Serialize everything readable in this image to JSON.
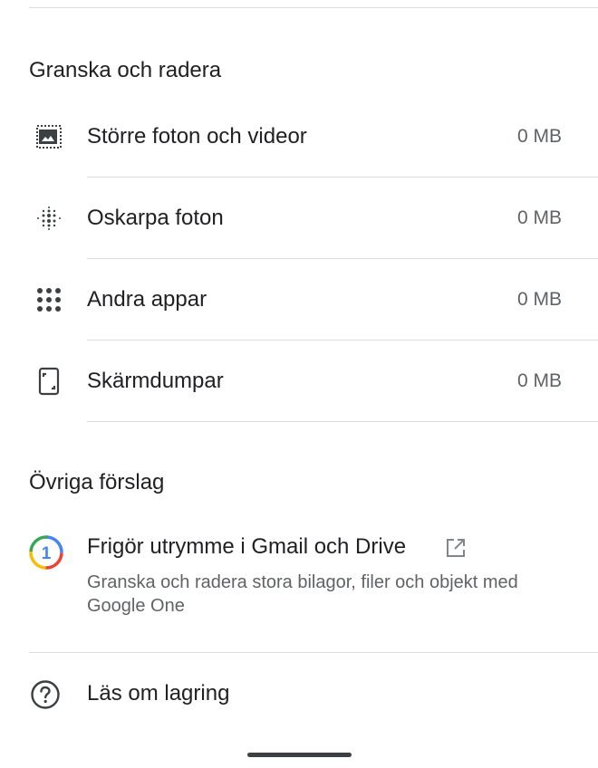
{
  "review": {
    "title": "Granska och radera",
    "items": [
      {
        "label": "Större foton och videor",
        "value": "0 MB",
        "icon": "large-photo-icon"
      },
      {
        "label": "Oskarpa foton",
        "value": "0 MB",
        "icon": "blurry-dots-icon"
      },
      {
        "label": "Andra appar",
        "value": "0 MB",
        "icon": "apps-grid-icon"
      },
      {
        "label": "Skärmdumpar",
        "value": "0 MB",
        "icon": "screenshot-phone-icon"
      }
    ]
  },
  "suggestions": {
    "title": "Övriga förslag",
    "google_one": {
      "title": "Frigör utrymme i Gmail och Drive",
      "description": "Granska och radera stora bilagor, filer och objekt med Google One",
      "icon": "google-one-icon",
      "external_icon": "open-external-icon",
      "logo_text": "1"
    }
  },
  "help": {
    "label": "Läs om lagring",
    "icon": "help-circle-icon"
  },
  "colors": {
    "text_primary": "#202124",
    "text_secondary": "#5f6368",
    "divider": "#dadce0",
    "icon": "#3c4043"
  }
}
